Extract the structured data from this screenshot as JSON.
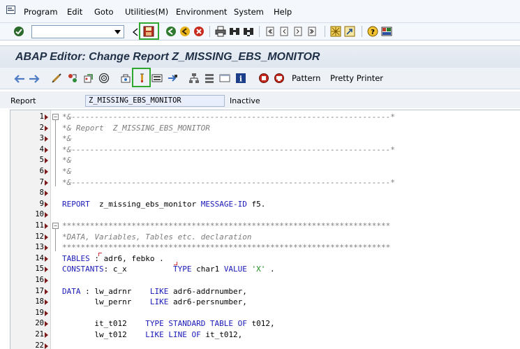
{
  "menu": {
    "items": [
      "Program",
      "Edit",
      "Goto",
      "Utilities(M)",
      "Environment",
      "System",
      "Help"
    ]
  },
  "toolbar": {
    "command_field_value": "",
    "icons": [
      "enter-icon",
      "command-field-dropdown-icon",
      "back-triangle-icon",
      "save-icon",
      "back-icon",
      "exit-icon",
      "cancel-icon",
      "print-icon",
      "find-icon",
      "find-next-icon",
      "first-page-icon",
      "previous-page-icon",
      "next-page-icon",
      "last-page-icon",
      "create-session-icon",
      "shortcut-icon",
      "help-icon",
      "customize-layout-icon"
    ]
  },
  "title": "ABAP Editor: Change Report Z_MISSING_EBS_MONITOR",
  "app_toolbar": {
    "icons": [
      "back-arrow-icon",
      "forward-arrow-icon",
      "display-change-icon",
      "other-object-icon",
      "active-inactive-icon",
      "where-used-icon",
      "check-syntax-icon",
      "activate-icon",
      "test-icon",
      "display-object-list-icon",
      "navigation-icon",
      "hierarchy-icon",
      "display-icon",
      "info-icon",
      "breakpoint-icon",
      "session-breakpoint-icon"
    ],
    "pattern_label": "Pattern",
    "pretty_printer_label": "Pretty Printer"
  },
  "report": {
    "label": "Report",
    "value": "Z_MISSING_EBS_MONITOR",
    "status": "Inactive"
  },
  "code_lines": [
    {
      "n": "1",
      "text": "*&---------------------------------------------------------------------*"
    },
    {
      "n": "2",
      "text": "*& Report  Z_MISSING_EBS_MONITOR"
    },
    {
      "n": "3",
      "text": "*&"
    },
    {
      "n": "4",
      "text": "*&---------------------------------------------------------------------*"
    },
    {
      "n": "5",
      "text": "*&"
    },
    {
      "n": "6",
      "text": "*&"
    },
    {
      "n": "7",
      "text": "*&---------------------------------------------------------------------*"
    },
    {
      "n": "8",
      "text": ""
    },
    {
      "n": "9",
      "kw1": "REPORT",
      "mid": "  z_missing_ebs_monitor ",
      "kw2": "MESSAGE-ID",
      "tail": " f5."
    },
    {
      "n": "10",
      "text": ""
    },
    {
      "n": "11",
      "text": "***********************************************************************"
    },
    {
      "n": "12",
      "text": "*DATA, Variables, Tables etc. declaration"
    },
    {
      "n": "13",
      "text": "***********************************************************************"
    },
    {
      "n": "14",
      "kw1": "TABLES",
      "mid": " : adr6, febko .",
      "kw2": "",
      "tail": ""
    },
    {
      "n": "15",
      "kw1": "CONSTANTS",
      "mid": ": c_x          ",
      "kw2": "TYPE",
      "tail": " char1 ",
      "kw3": "VALUE",
      "str": " 'X'",
      "end": " ."
    },
    {
      "n": "16",
      "text": ""
    },
    {
      "n": "17",
      "kw1": "DATA",
      "mid": " : lw_adrnr    ",
      "kw2": "LIKE",
      "tail": " adr6-addrnumber,"
    },
    {
      "n": "18",
      "kw1": "",
      "mid": "       lw_pernr    ",
      "kw2": "LIKE",
      "tail": " adr6-persnumber,"
    },
    {
      "n": "19",
      "text": ""
    },
    {
      "n": "20",
      "kw1": "",
      "mid": "       it_t012    ",
      "kw2": "TYPE STANDARD TABLE OF",
      "tail": " t012,"
    },
    {
      "n": "21",
      "kw1": "",
      "mid": "       lw_t012    ",
      "kw2": "LIKE LINE OF",
      "tail": " it_t012,"
    },
    {
      "n": "22",
      "text": ""
    }
  ]
}
